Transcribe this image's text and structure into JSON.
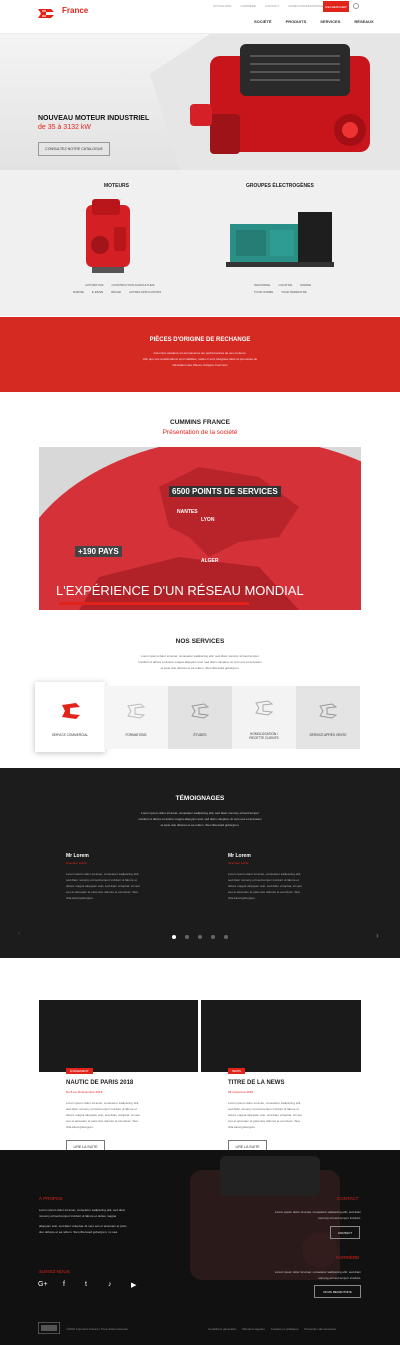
{
  "brand": {
    "name": "France"
  },
  "topbar": {
    "links": [
      "ACTUALITÉS",
      "CARRIÈRE",
      "CONTACT",
      "ZONES PROFESSIONNELS"
    ],
    "search_button": "RECHERCHER"
  },
  "nav": {
    "items": [
      "SOCIÉTÉ",
      "PRODUITS",
      "SERVICES",
      "RÉSEAUX"
    ]
  },
  "hero": {
    "title": "NOUVEAU MOTEUR INDUSTRIEL",
    "subtitle": "de 35 à 3132 kW",
    "button": "CONSULTEZ NOTRE CATALOGUE"
  },
  "products": {
    "engines": {
      "title": "MOTEURS",
      "links_row1": [
        "AUTOMOTIVE",
        "CONSTRUCTION AGRICULTURE"
      ],
      "links_row2": [
        "MARINE",
        "E-DRIVE",
        "RÉCHE",
        "AUTRES APPLICATIONS"
      ]
    },
    "gensets": {
      "title": "GROUPES ÉLECTROGÈNES",
      "links_row1": [
        "INDUSTRIEL",
        "LOCATIVE",
        "MARINE"
      ],
      "links_row2": [
        "TOUR NORME",
        "TOUR TERRESTRE"
      ]
    }
  },
  "parts": {
    "title": "PIÈCES D'ORIGINE DE RECHANGE",
    "lines": [
      "Cummins améliore en permanence les performances de ses moteurs.",
      "Afin que vos améliorations sont valables, celles ci sont intégrées dans la promesse de",
      "fabrication des Pièces d'origine Cummins"
    ]
  },
  "company": {
    "title": "CUMMINS FRANCE",
    "subtitle": "Présentation de la société",
    "video": {
      "points": "6500 POINTS DE SERVICES",
      "countries": "+190 PAYS",
      "cities": [
        "NANTES",
        "LYON",
        "ALGER"
      ],
      "headline": "L'EXPÉRIENCE D'UN RÉSEAU MONDIAL"
    }
  },
  "services": {
    "title": "NOS SERVICES",
    "lines": [
      "Lorem ipsum dolor sit amet, consetetur sadipscing elitr, sed diam nonumy eirmod tempor",
      "invidunt ut labore et dolore magna aliquyam erat, sed diam voluptua. At vero eos et accusam",
      "et justo duo dolores et ea rebum. Stet clita kasd gubergren."
    ],
    "tiles": [
      "SERVICE COMMERCIAL",
      "FORMATIONS",
      "ÉTUDES",
      "HOMOLOGATION / RECETTE CLIENTS",
      "SERVICE APRÈS VENTE"
    ]
  },
  "testimonials": {
    "title": "TÉMOIGNAGES",
    "lines": [
      "Lorem ipsum dolor sit amet, consetetur sadipscing elitr, sed diam nonumy eirmod tempor",
      "invidunt ut labore et dolore magna aliquyam erat, sed diam voluptua. At vero eos et accusam",
      "et justo duo dolores et ea rebum. Stet clita kasd gubergren."
    ],
    "items": [
      {
        "name": "Mr Lorem",
        "role": "Directeur Achat",
        "lines": [
          "Lorem ipsum dolor sit amet, consetetur sadipscing elitr,",
          "sed diam nonumy eirmod tempor invidunt ut labore et",
          "dolore magna aliquyam erat, sed diam voluptua. At vero",
          "eos et accusam et justo duo dolores et ea rebum. Stet",
          "clita kasd gubergren."
        ]
      },
      {
        "name": "Mr Lorem",
        "role": "Directeur Achat",
        "lines": [
          "Lorem ipsum dolor sit amet, consetetur sadipscing elitr,",
          "sed diam nonumy eirmod tempor invidunt ut labore et",
          "dolore magna aliquyam erat, sed diam voluptua. At vero",
          "eos et accusam et justo duo dolores et ea rebum. Stet",
          "clita kasd gubergren."
        ]
      }
    ]
  },
  "news": [
    {
      "tag": "ÉVÉNEMENT",
      "title": "NAUTIC DE PARIS 2018",
      "date": "Du 8 au 16 décembre 2018",
      "lines": [
        "Lorem ipsum dolor sit amet, consetetur sadipscing elitr,",
        "sed diam nonumy eirmod tempor invidunt ut labore et",
        "dolore magna aliquyam erat, sed diam voluptua. At vero",
        "eos et accusam et justo duo dolores et ea rebum. Stet",
        "clita kasd gubergren."
      ],
      "button": "LIRE LA SUITE"
    },
    {
      "tag": "NEWS",
      "title": "TITRE DE LA NEWS",
      "date": "28 novembre 2018",
      "lines": [
        "Lorem ipsum dolor sit amet, consetetur sadipscing elitr,",
        "sed diam nonumy eirmod tempor invidunt ut labore et",
        "dolore magna aliquyam erat, sed diam voluptua. At vero",
        "eos et accusam et justo duo dolores et ea rebum. Stet",
        "clita kasd gubergren."
      ],
      "button": "LIRE LA SUITE"
    }
  ],
  "footer": {
    "about_title": "À PROPOS",
    "about_lines": [
      "Lorem ipsum dolor sit amet, consetetur sadipscing elitr, sed diam",
      "nonumy eirmod tempor invidunt ut labore et dolore magna",
      "aliquyam erat, sed diam voluptua. At vero eos et accusam et justo",
      "duo dolores et ea rebum. Stet clita kasd gubergren, no sea."
    ],
    "contact_title": "CONTACT",
    "contact_lines": [
      "Lorem ipsum dolor sit amet, consetetur sadipscing elitr, sed diam",
      "nonumy eirmod tempor invidunt."
    ],
    "contact_button": "CONTACT",
    "recruit_title": "CARRIÈRE",
    "recruit_lines": [
      "Lorem ipsum dolor sit amet, consetetur sadipscing elitr, sed diam",
      "nonumy eirmod tempor invidunt."
    ],
    "recruit_button": "NOUS RECRUTONS",
    "social_title": "SUIVEZ-NOUS",
    "copyright": "©2019 Cummins France | Tous droits réservés",
    "legal": [
      "Conditions générales",
      "Mentions légales",
      "Cookies et politiques",
      "Protection des données"
    ]
  },
  "colors": {
    "accent": "#e2231a",
    "dark": "#1c1c1c"
  }
}
